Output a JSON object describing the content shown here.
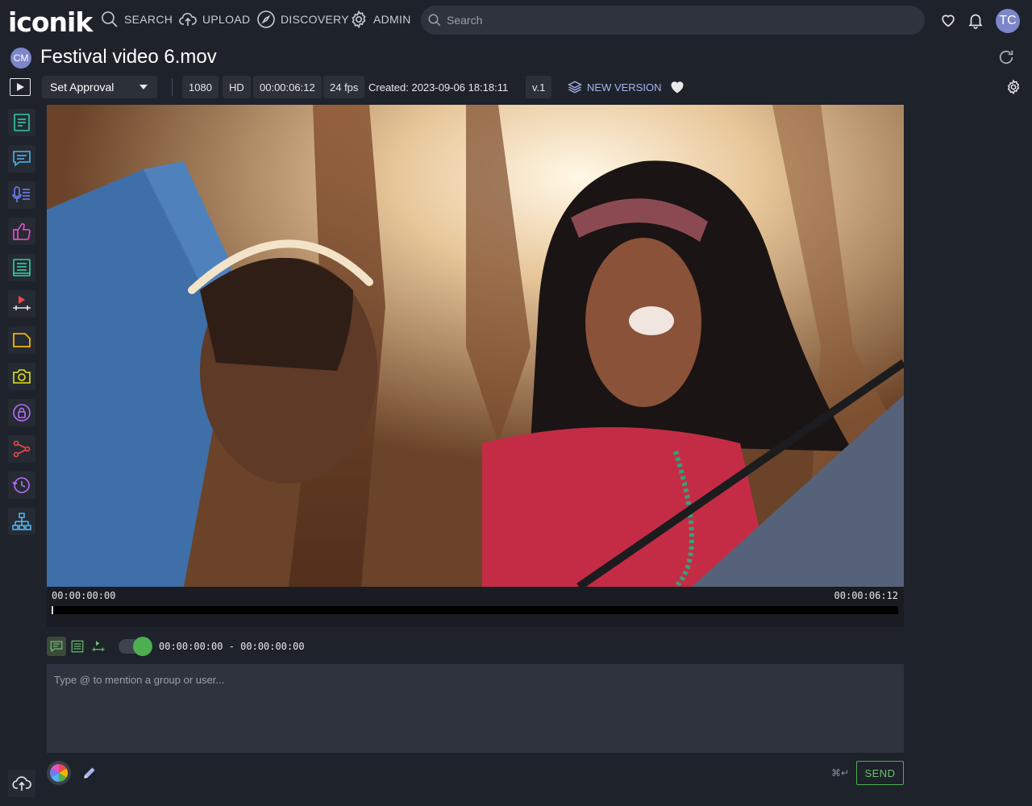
{
  "app": {
    "logo": "iconik"
  },
  "nav": [
    {
      "label": "SEARCH"
    },
    {
      "label": "UPLOAD"
    },
    {
      "label": "DISCOVERY"
    },
    {
      "label": "ADMIN"
    }
  ],
  "search": {
    "placeholder": "Search"
  },
  "user": {
    "initials": "TC"
  },
  "asset": {
    "owner_initials": "CM",
    "title": "Festival video 6.mov",
    "approval_label": "Set Approval",
    "resolution": "1080",
    "quality": "HD",
    "duration": "00:00:06:12",
    "fps": "24 fps",
    "created": "Created: 2023-09-06 18:18:11",
    "version": "v.1",
    "new_version_label": "NEW VERSION"
  },
  "timeline": {
    "start_tc": "00:00:00:00",
    "end_tc": "00:00:06:12",
    "playhead_fraction": 0
  },
  "comment": {
    "range": "00:00:00:00 - 00:00:00:00",
    "placeholder": "Type @ to mention a group or user...",
    "shortcut": "⌘↵",
    "send_label": "SEND"
  },
  "colors": {
    "background": "#1e222b",
    "accent_green": "#4caf50",
    "avatar": "#7c86c9"
  }
}
